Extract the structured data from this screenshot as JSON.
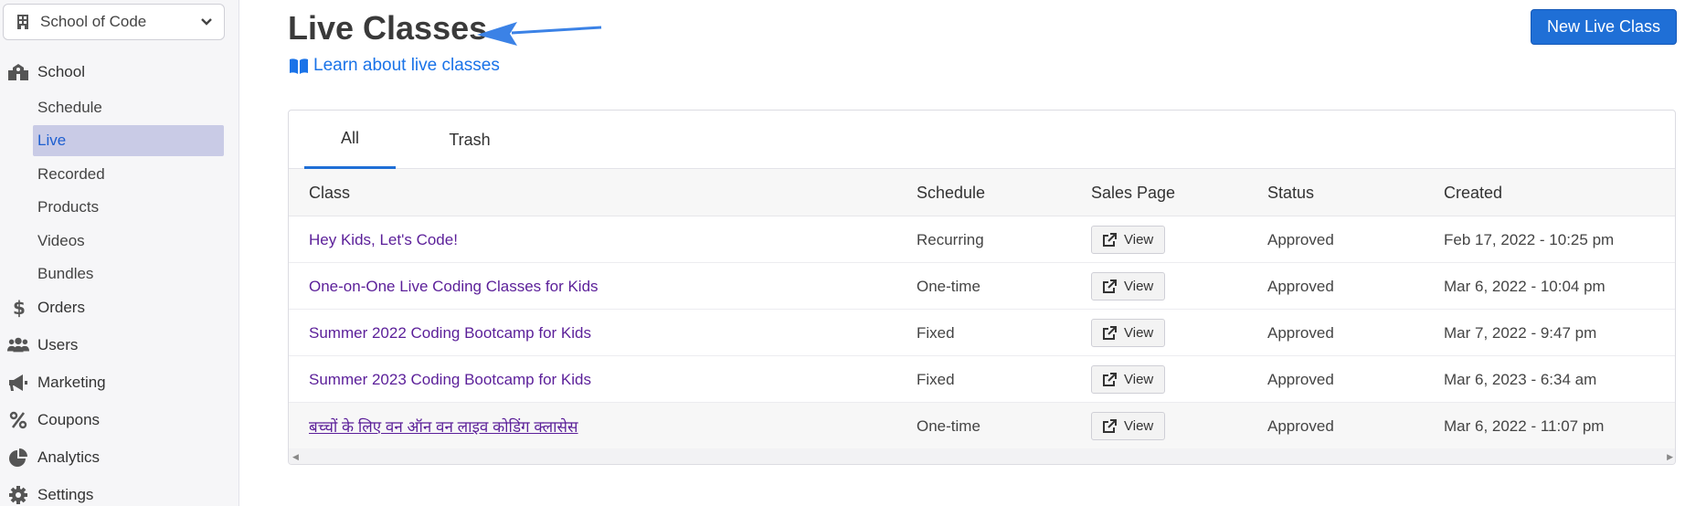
{
  "sidebar": {
    "school_select": "School of Code",
    "items": [
      {
        "label": "School",
        "icon": "school-building-icon"
      },
      {
        "label": "Orders",
        "icon": "dollar-icon"
      },
      {
        "label": "Users",
        "icon": "users-icon"
      },
      {
        "label": "Marketing",
        "icon": "megaphone-icon"
      },
      {
        "label": "Coupons",
        "icon": "percent-icon"
      },
      {
        "label": "Analytics",
        "icon": "pie-chart-icon"
      },
      {
        "label": "Settings",
        "icon": "gear-icon"
      }
    ],
    "school_sub": [
      "Schedule",
      "Live",
      "Recorded",
      "Products",
      "Videos",
      "Bundles"
    ],
    "active_sub": "Live"
  },
  "header": {
    "title": "Live Classes",
    "learn_link": "Learn about live classes",
    "new_button": "New Live Class"
  },
  "tabs": [
    "All",
    "Trash"
  ],
  "active_tab": "All",
  "table": {
    "columns": [
      "Class",
      "Schedule",
      "Sales Page",
      "Status",
      "Created"
    ],
    "rows": [
      {
        "class": "Hey Kids, Let's Code!",
        "schedule": "Recurring",
        "sales": "View",
        "status": "Approved",
        "created": "Feb 17, 2022 - 10:25 pm"
      },
      {
        "class": "One-on-One Live Coding Classes for Kids",
        "schedule": "One-time",
        "sales": "View",
        "status": "Approved",
        "created": "Mar 6, 2022 - 10:04 pm"
      },
      {
        "class": "Summer 2022 Coding Bootcamp for Kids",
        "schedule": "Fixed",
        "sales": "View",
        "status": "Approved",
        "created": "Mar 7, 2022 - 9:47 pm"
      },
      {
        "class": "Summer 2023 Coding Bootcamp for Kids",
        "schedule": "Fixed",
        "sales": "View",
        "status": "Approved",
        "created": "Mar 6, 2023 - 6:34 am"
      },
      {
        "class": "बच्चों के लिए वन ऑन वन लाइव कोडिंग क्लासेस",
        "schedule": "One-time",
        "sales": "View",
        "status": "Approved",
        "created": "Mar 6, 2022 - 11:07 pm"
      }
    ]
  },
  "colors": {
    "accent": "#1f6fd6",
    "link": "#1a73e8",
    "class_link": "#5b1f99",
    "active_bg": "#c9cbe6"
  }
}
